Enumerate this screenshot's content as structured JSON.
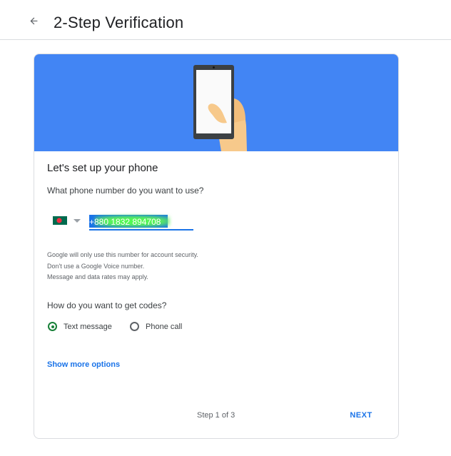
{
  "header": {
    "title": "2-Step Verification",
    "back_icon": "arrow-back-icon"
  },
  "card": {
    "hero_icon": "phone-in-hand-illustration",
    "title": "Let's set up your phone",
    "phone_question": "What phone number do you want to use?",
    "country": {
      "flag_icon": "bangladesh-flag-icon",
      "dropdown_icon": "dropdown-triangle-icon"
    },
    "phone_input": {
      "value": "+880 1832 894708"
    },
    "disclaimer": [
      "Google will only use this number for account security.",
      "Don't use a Google Voice number.",
      "Message and data rates may apply."
    ],
    "codes_question": "How do you want to get codes?",
    "options": [
      {
        "label": "Text message",
        "checked": true
      },
      {
        "label": "Phone call",
        "checked": false
      }
    ],
    "show_more": "Show more options",
    "step": "Step 1 of 3",
    "next": "NEXT"
  },
  "colors": {
    "hero_bg": "#4285f4",
    "link": "#1a73e8",
    "radio_checked": "#188038",
    "flag_green": "#006a4e",
    "flag_red": "#f42a41"
  }
}
